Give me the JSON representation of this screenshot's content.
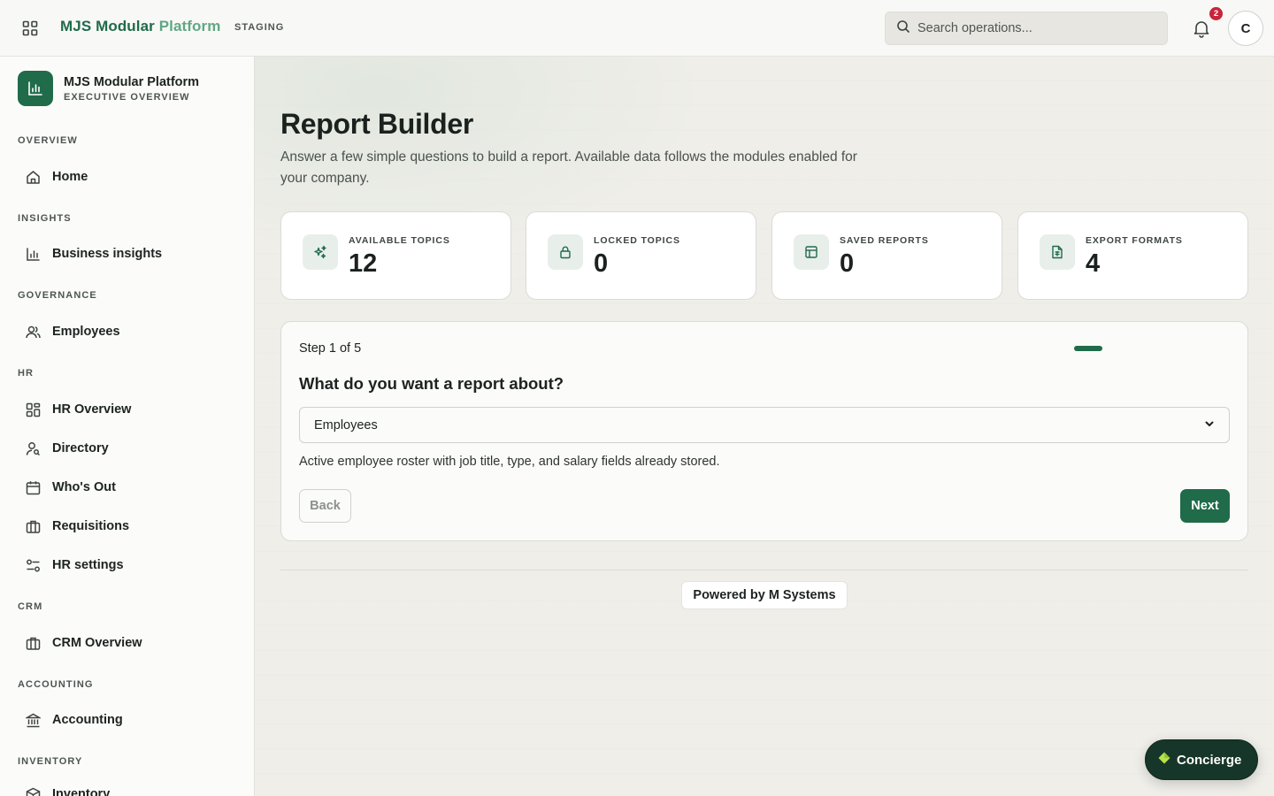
{
  "topbar": {
    "brand_part1": "MJS Modular",
    "brand_part2": "Platform",
    "environment": "STAGING",
    "search_placeholder": "Search operations...",
    "notification_count": "2",
    "avatar_initial": "C"
  },
  "sidebar": {
    "org_name": "MJS Modular Platform",
    "org_subtitle": "EXECUTIVE OVERVIEW",
    "sections": {
      "overview": "OVERVIEW",
      "insights": "INSIGHTS",
      "governance": "GOVERNANCE",
      "hr": "HR",
      "crm": "CRM",
      "accounting": "ACCOUNTING",
      "inventory": "INVENTORY"
    },
    "items": {
      "home": "Home",
      "business_insights": "Business insights",
      "employees": "Employees",
      "hr_overview": "HR Overview",
      "directory": "Directory",
      "whos_out": "Who's Out",
      "requisitions": "Requisitions",
      "hr_settings": "HR settings",
      "crm_overview": "CRM Overview",
      "accounting": "Accounting",
      "inventory": "Inventory"
    }
  },
  "page": {
    "title": "Report Builder",
    "description": "Answer a few simple questions to build a report. Available data follows the modules enabled for your company."
  },
  "stats": [
    {
      "label": "AVAILABLE TOPICS",
      "value": "12",
      "icon": "sparkles-icon"
    },
    {
      "label": "LOCKED TOPICS",
      "value": "0",
      "icon": "lock-icon"
    },
    {
      "label": "SAVED REPORTS",
      "value": "0",
      "icon": "table-icon"
    },
    {
      "label": "EXPORT FORMATS",
      "value": "4",
      "icon": "file-spreadsheet-icon"
    }
  ],
  "wizard": {
    "step_text": "Step 1 of 5",
    "current_step": 1,
    "total_steps": 5,
    "question": "What do you want a report about?",
    "selected_topic": "Employees",
    "topic_description": "Active employee roster with job title, type, and salary fields already stored.",
    "back_label": "Back",
    "next_label": "Next"
  },
  "footer": {
    "powered_by": "Powered by M Systems"
  },
  "concierge": {
    "label": "Concierge"
  },
  "colors": {
    "brand_green": "#1f6b4a",
    "brand_green_light": "#5fa883",
    "badge_red": "#c8253a",
    "concierge_bg": "#17362a",
    "concierge_gem": "#b7e34a"
  }
}
